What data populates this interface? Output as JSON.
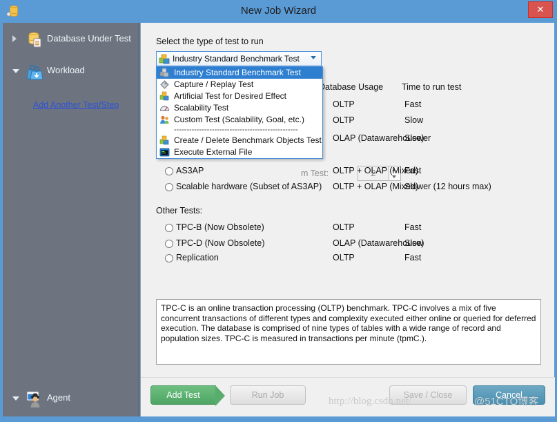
{
  "window": {
    "title": "New Job Wizard",
    "icon": "database-icon",
    "close_label": "✕"
  },
  "sidebar": {
    "items": [
      {
        "label": "Database Under Test",
        "icon": "database-under-test-icon",
        "expander": "collapsed"
      },
      {
        "label": "Workload",
        "icon": "workload-weights-icon",
        "expander": "expanded"
      },
      {
        "label": "Agent",
        "icon": "agent-icon",
        "expander": "expanded"
      }
    ],
    "link": "Add Another Test/Step"
  },
  "main": {
    "hint": "Select the type of test to run",
    "combo": {
      "value": "Industry Standard Benchmark Test",
      "icon": "test-type-icon",
      "options": [
        {
          "label": "Industry Standard Benchmark Test",
          "icon": "benchmark-icon",
          "selected": true,
          "separator": false
        },
        {
          "label": "Capture / Replay Test",
          "icon": "diamond-icon",
          "selected": false,
          "separator": false
        },
        {
          "label": "Artificial Test for Desired Effect",
          "icon": "blocks-icon",
          "selected": false,
          "separator": false
        },
        {
          "label": "Scalability Test",
          "icon": "gauge-icon",
          "separator": false,
          "selected": false
        },
        {
          "label": "Custom Test (Scalability, Goal, etc.)",
          "icon": "people-icon",
          "selected": false,
          "separator": false
        },
        {
          "label": "-------------------------------------------------",
          "icon": "",
          "selected": false,
          "separator": true
        },
        {
          "label": "Create / Delete Benchmark Objects Test",
          "icon": "blocks-icon",
          "selected": false,
          "separator": false
        },
        {
          "label": "Execute External File",
          "icon": "terminal-icon",
          "selected": false,
          "separator": false
        }
      ]
    },
    "columns": {
      "usage": "Database Usage",
      "time": "Time to run test"
    },
    "hidden_rows": [
      {
        "label": "",
        "usage": "OLTP",
        "time": "Fast"
      },
      {
        "label": "",
        "usage": "OLTP",
        "time": "Slow"
      },
      {
        "label": "",
        "usage": "OLAP (Datawarehouse)",
        "time": "Slower"
      }
    ],
    "spinner": {
      "label": "m Test:",
      "value": "2"
    },
    "rows": [
      {
        "label": "AS3AP",
        "usage": "OLTP + OLAP (Mixed)",
        "time": "Fast",
        "checked": false
      },
      {
        "label": "Scalable hardware (Subset of AS3AP)",
        "usage": "OLTP + OLAP (Mixed)",
        "time": "Slower (12 hours max)",
        "checked": false
      }
    ],
    "other_tests_label": "Other Tests:",
    "other_rows": [
      {
        "label": "TPC-B (Now Obsolete)",
        "usage": "OLTP",
        "time": "Fast",
        "checked": false
      },
      {
        "label": "TPC-D (Now Obsolete)",
        "usage": "OLAP (Datawarehouse)",
        "time": "Slow",
        "checked": false
      },
      {
        "label": "Replication",
        "usage": "OLTP",
        "time": "Fast",
        "checked": false
      }
    ],
    "description": "TPC-C is an online transaction processing (OLTP) benchmark.  TPC-C involves a mix of five concurrent transactions of different types and complexity executed either online or queried for deferred execution.  The database is comprised of nine types of tables with a wide range of record and population sizes.  TPC-C is measured in transactions per minute (tpmC.)."
  },
  "buttons": {
    "add_test": "Add Test",
    "run_job": "Run Job",
    "save_close": "Save / Close",
    "cancel": "Cancel"
  },
  "watermark": {
    "url": "http://blog.csdn.net/",
    "tag": "@51CTO博客"
  },
  "colors": {
    "title_bar": "#5b9bd5",
    "sidebar": "#6d7480",
    "content": "#f0f0f0",
    "accent_select": "#2f7fd1",
    "close": "#d9534f",
    "add_test": "#4fa564",
    "cancel": "#4a8fb0",
    "link": "#2d52d6"
  }
}
